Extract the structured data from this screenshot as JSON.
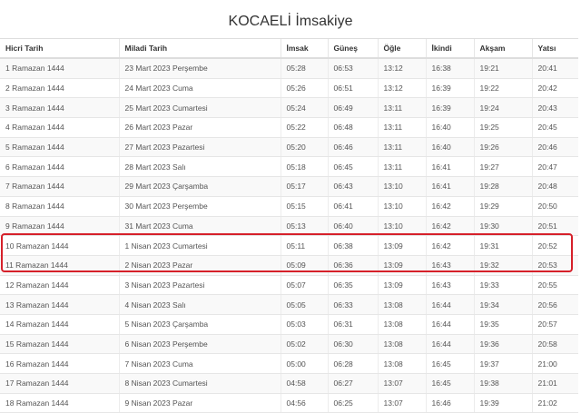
{
  "page": {
    "title": "KOCAELİ İmsakiye"
  },
  "table": {
    "headers": [
      "Hicri Tarih",
      "Miladi Tarih",
      "İmsak",
      "Güneş",
      "Öğle",
      "İkindi",
      "Akşam",
      "Yatsı"
    ],
    "rows": [
      [
        "1 Ramazan 1444",
        "23 Mart 2023 Perşembe",
        "05:28",
        "06:53",
        "13:12",
        "16:38",
        "19:21",
        "20:41"
      ],
      [
        "2 Ramazan 1444",
        "24 Mart 2023 Cuma",
        "05:26",
        "06:51",
        "13:12",
        "16:39",
        "19:22",
        "20:42"
      ],
      [
        "3 Ramazan 1444",
        "25 Mart 2023 Cumartesi",
        "05:24",
        "06:49",
        "13:11",
        "16:39",
        "19:24",
        "20:43"
      ],
      [
        "4 Ramazan 1444",
        "26 Mart 2023 Pazar",
        "05:22",
        "06:48",
        "13:11",
        "16:40",
        "19:25",
        "20:45"
      ],
      [
        "5 Ramazan 1444",
        "27 Mart 2023 Pazartesi",
        "05:20",
        "06:46",
        "13:11",
        "16:40",
        "19:26",
        "20:46"
      ],
      [
        "6 Ramazan 1444",
        "28 Mart 2023 Salı",
        "05:18",
        "06:45",
        "13:11",
        "16:41",
        "19:27",
        "20:47"
      ],
      [
        "7 Ramazan 1444",
        "29 Mart 2023 Çarşamba",
        "05:17",
        "06:43",
        "13:10",
        "16:41",
        "19:28",
        "20:48"
      ],
      [
        "8 Ramazan 1444",
        "30 Mart 2023 Perşembe",
        "05:15",
        "06:41",
        "13:10",
        "16:42",
        "19:29",
        "20:50"
      ],
      [
        "9 Ramazan 1444",
        "31 Mart 2023 Cuma",
        "05:13",
        "06:40",
        "13:10",
        "16:42",
        "19:30",
        "20:51"
      ],
      [
        "10 Ramazan 1444",
        "1 Nisan 2023 Cumartesi",
        "05:11",
        "06:38",
        "13:09",
        "16:42",
        "19:31",
        "20:52"
      ],
      [
        "11 Ramazan 1444",
        "2 Nisan 2023 Pazar",
        "05:09",
        "06:36",
        "13:09",
        "16:43",
        "19:32",
        "20:53"
      ],
      [
        "12 Ramazan 1444",
        "3 Nisan 2023 Pazartesi",
        "05:07",
        "06:35",
        "13:09",
        "16:43",
        "19:33",
        "20:55"
      ],
      [
        "13 Ramazan 1444",
        "4 Nisan 2023 Salı",
        "05:05",
        "06:33",
        "13:08",
        "16:44",
        "19:34",
        "20:56"
      ],
      [
        "14 Ramazan 1444",
        "5 Nisan 2023 Çarşamba",
        "05:03",
        "06:31",
        "13:08",
        "16:44",
        "19:35",
        "20:57"
      ],
      [
        "15 Ramazan 1444",
        "6 Nisan 2023 Perşembe",
        "05:02",
        "06:30",
        "13:08",
        "16:44",
        "19:36",
        "20:58"
      ],
      [
        "16 Ramazan 1444",
        "7 Nisan 2023 Cuma",
        "05:00",
        "06:28",
        "13:08",
        "16:45",
        "19:37",
        "21:00"
      ],
      [
        "17 Ramazan 1444",
        "8 Nisan 2023 Cumartesi",
        "04:58",
        "06:27",
        "13:07",
        "16:45",
        "19:38",
        "21:01"
      ],
      [
        "18 Ramazan 1444",
        "9 Nisan 2023 Pazar",
        "04:56",
        "06:25",
        "13:07",
        "16:46",
        "19:39",
        "21:02"
      ]
    ]
  },
  "highlight": {
    "rows": [
      10,
      11
    ],
    "color": "#d6202a"
  }
}
